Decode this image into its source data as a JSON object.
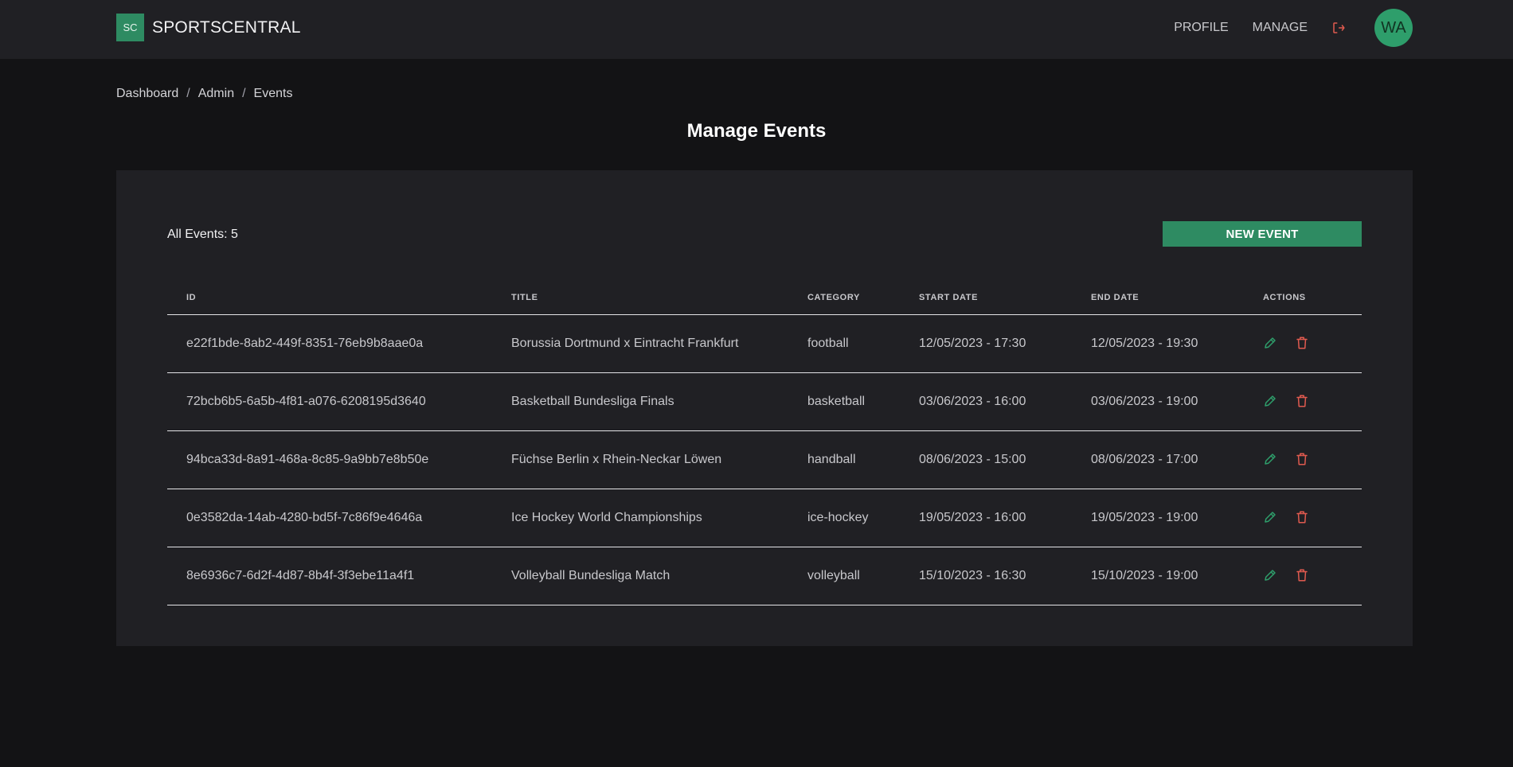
{
  "header": {
    "logo_text": "SC",
    "brand": "SPORTSCENTRAL",
    "nav": {
      "profile": "PROFILE",
      "manage": "MANAGE"
    },
    "logout_icon": "logout-icon",
    "avatar_initials": "WA",
    "colors": {
      "accent": "#2e8b62",
      "avatar": "#2e9e6b",
      "logout": "#e05a4f"
    }
  },
  "breadcrumb": {
    "items": [
      "Dashboard",
      "Admin",
      "Events"
    ],
    "separator": "/"
  },
  "page": {
    "title": "Manage Events"
  },
  "panel": {
    "count_label": "All Events: 5",
    "new_button": "NEW EVENT"
  },
  "table": {
    "headers": {
      "id": "ID",
      "title": "TITLE",
      "category": "CATEGORY",
      "start": "START DATE",
      "end": "END DATE",
      "actions": "ACTIONS"
    },
    "rows": [
      {
        "id": "e22f1bde-8ab2-449f-8351-76eb9b8aae0a",
        "title": "Borussia Dortmund x Eintracht Frankfurt",
        "category": "football",
        "start": "12/05/2023 - 17:30",
        "end": "12/05/2023 - 19:30"
      },
      {
        "id": "72bcb6b5-6a5b-4f81-a076-6208195d3640",
        "title": "Basketball Bundesliga Finals",
        "category": "basketball",
        "start": "03/06/2023 - 16:00",
        "end": "03/06/2023 - 19:00"
      },
      {
        "id": "94bca33d-8a91-468a-8c85-9a9bb7e8b50e",
        "title": "Füchse Berlin x Rhein-Neckar Löwen",
        "category": "handball",
        "start": "08/06/2023 - 15:00",
        "end": "08/06/2023 - 17:00"
      },
      {
        "id": "0e3582da-14ab-4280-bd5f-7c86f9e4646a",
        "title": "Ice Hockey World Championships",
        "category": "ice-hockey",
        "start": "19/05/2023 - 16:00",
        "end": "19/05/2023 - 19:00"
      },
      {
        "id": "8e6936c7-6d2f-4d87-8b4f-3f3ebe11a4f1",
        "title": "Volleyball Bundesliga Match",
        "category": "volleyball",
        "start": "15/10/2023 - 16:30",
        "end": "15/10/2023 - 19:00"
      }
    ],
    "action_icons": {
      "edit": "pencil-icon",
      "delete": "trash-icon"
    },
    "colors": {
      "edit": "#2e9e6b",
      "delete": "#e05a4f"
    }
  }
}
